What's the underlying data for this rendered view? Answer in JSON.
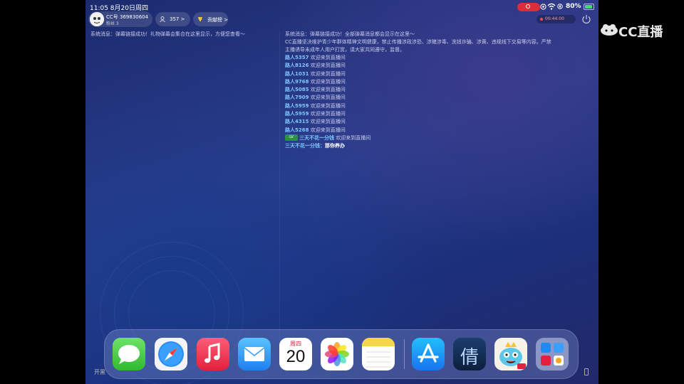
{
  "status_bar": {
    "time_date": "11:05   8月20日周四",
    "battery": "80%"
  },
  "host": {
    "cc_id": "CC号 369830604",
    "sub": "粉丝 3"
  },
  "chips": {
    "viewers": "357 >",
    "contribution": "贡献榜 >"
  },
  "timer": "00:44:00",
  "chat_left": "系统消息：弹幕链接成功！礼物弹幕会集合在这里显示，方便您查看～",
  "chat_right": {
    "notice_1": "系统消息：弹幕链接成功！全部弹幕消息都会显示在这里～",
    "notice_2_line1": "CC直播坚决维护青少年群体精神文明健康，禁止传播涉政涉恐、涉赌涉毒、洗钱诈骗、涉黄、违规线下交易等内容。严禁",
    "notice_2_line2": "主播诱导未成年人用户打赏，请大家共同遵守，监督。",
    "joins": [
      {
        "user": "路人5357",
        "text": "欢迎来到直播间"
      },
      {
        "user": "路人8126",
        "text": "欢迎来到直播间"
      },
      {
        "user": "路人1031",
        "text": "欢迎来到直播间"
      },
      {
        "user": "路人9768",
        "text": "欢迎来到直播间"
      },
      {
        "user": "路人5085",
        "text": "欢迎来到直播间"
      },
      {
        "user": "路人7909",
        "text": "欢迎来到直播间"
      },
      {
        "user": "路人5959",
        "text": "欢迎来到直播间"
      },
      {
        "user": "路人5959",
        "text": "欢迎来到直播间"
      },
      {
        "user": "路人4315",
        "text": "欢迎来到直播间"
      },
      {
        "user": "路人5268",
        "text": "欢迎来到直播间"
      }
    ],
    "vip_badge": "LV",
    "vip_user": "三天不花一分钱",
    "vip_text": "欢迎来到直播间",
    "chat_user": "三天不花一分钱：",
    "chat_text": "那你养办"
  },
  "input": {
    "placeholder": "开黑"
  },
  "dock": {
    "calendar_weekday": "周四",
    "calendar_day": "20",
    "game_glyph": "倩",
    "apps": [
      "messages-app",
      "safari-app",
      "music-app",
      "mail-app",
      "calendar-app",
      "photos-app",
      "notes-app",
      "app-store",
      "game-app",
      "cartoon-game-app",
      "app-folder"
    ]
  },
  "logo": "CC直播"
}
